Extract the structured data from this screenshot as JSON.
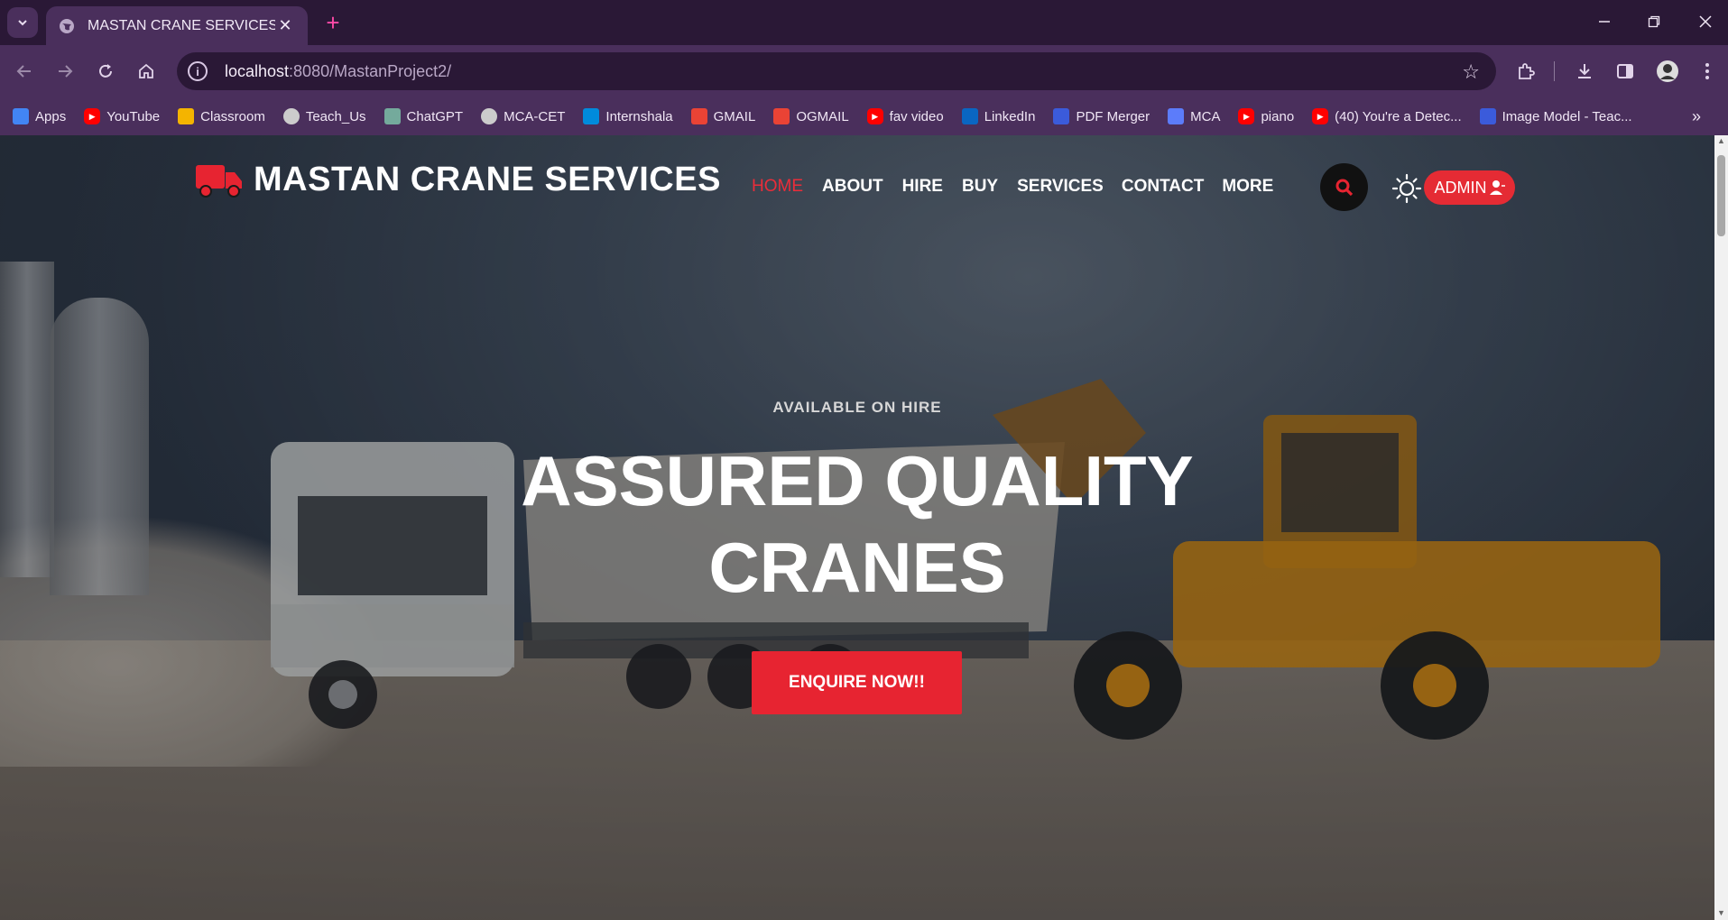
{
  "browser": {
    "tab_title": "MASTAN CRANE SERVICES",
    "tab_close": "✕",
    "new_tab": "+",
    "url_host": "localhost",
    "url_rest": ":8080/MastanProject2/",
    "bookmarks": [
      {
        "label": "Apps",
        "icon": "apps-grid-icon",
        "color": "#4285f4"
      },
      {
        "label": "YouTube",
        "icon": "youtube-icon",
        "color": "#ff0000"
      },
      {
        "label": "Classroom",
        "icon": "classroom-icon",
        "color": "#f4b400"
      },
      {
        "label": "Teach_Us",
        "icon": "globe-icon",
        "color": "#cccccc"
      },
      {
        "label": "ChatGPT",
        "icon": "chatgpt-icon",
        "color": "#74aa9c"
      },
      {
        "label": "MCA-CET",
        "icon": "globe-icon",
        "color": "#cccccc"
      },
      {
        "label": "Internshala",
        "icon": "internshala-icon",
        "color": "#008bdc"
      },
      {
        "label": "GMAIL",
        "icon": "gmail-icon",
        "color": "#ea4335"
      },
      {
        "label": "OGMAIL",
        "icon": "gmail-icon",
        "color": "#ea4335"
      },
      {
        "label": "fav video",
        "icon": "youtube-icon",
        "color": "#ff0000"
      },
      {
        "label": "LinkedIn",
        "icon": "linkedin-icon",
        "color": "#0a66c2"
      },
      {
        "label": "PDF Merger",
        "icon": "pdf-merger-icon",
        "color": "#3b5bdb"
      },
      {
        "label": "MCA",
        "icon": "mca-icon",
        "color": "#5c7cfa"
      },
      {
        "label": "piano",
        "icon": "youtube-icon",
        "color": "#ff0000"
      },
      {
        "label": "(40) You're a Detec...",
        "icon": "youtube-icon",
        "color": "#ff0000"
      },
      {
        "label": "Image Model - Teac...",
        "icon": "tm-icon",
        "color": "#3b5bdb"
      }
    ],
    "more_bookmarks": "»"
  },
  "page": {
    "brand": "MASTAN CRANE SERVICES",
    "nav": [
      "HOME",
      "ABOUT",
      "HIRE",
      "BUY",
      "SERVICES",
      "CONTACT",
      "MORE"
    ],
    "admin_label": "ADMIN",
    "hero_subtitle": "AVAILABLE ON HIRE",
    "hero_title_line1": "ASSURED QUALITY",
    "hero_title_line2": "CRANES",
    "cta_label": "ENQUIRE NOW!!",
    "accent_color": "#e72431"
  }
}
